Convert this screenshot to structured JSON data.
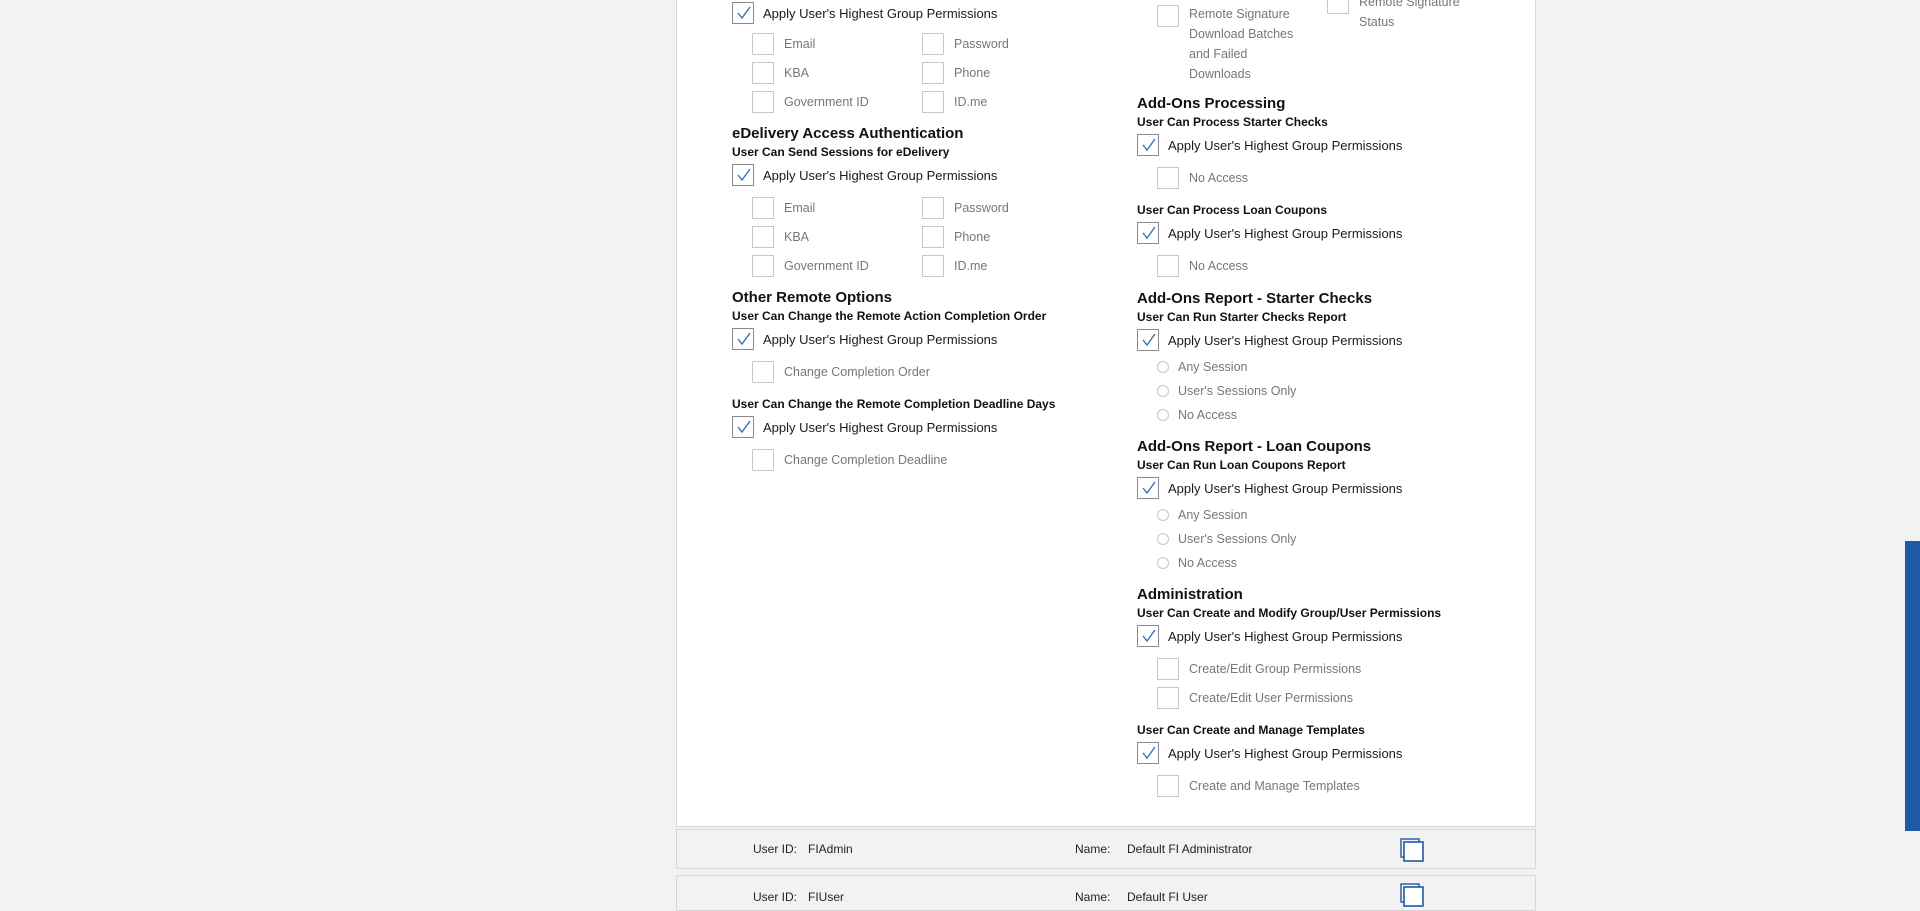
{
  "apply_label": "Apply User's Highest Group Permissions",
  "left": {
    "auth_top": {
      "items": [
        "Email",
        "Password",
        "KBA",
        "Phone",
        "Government ID",
        "ID.me"
      ]
    },
    "edelivery": {
      "title": "eDelivery Access Authentication",
      "perm": "User Can Send Sessions for eDelivery",
      "items": [
        "Email",
        "Password",
        "KBA",
        "Phone",
        "Government ID",
        "ID.me"
      ]
    },
    "other": {
      "title": "Other Remote Options",
      "perm1": "User Can Change the Remote Action Completion Order",
      "opt1": "Change Completion Order",
      "perm2": "User Can Change the Remote Completion Deadline Days",
      "opt2": "Change Completion Deadline"
    }
  },
  "right": {
    "top": {
      "opt_a": "Remote Signature Download Batches and Failed Downloads",
      "opt_b": "Remote Signature Status"
    },
    "processing": {
      "title": "Add-Ons Processing",
      "perm1": "User Can Process Starter Checks",
      "perm1_opt": "No Access",
      "perm2": "User Can Process Loan Coupons",
      "perm2_opt": "No Access"
    },
    "report_starter": {
      "title": "Add-Ons Report - Starter Checks",
      "perm": "User Can Run Starter Checks Report",
      "options": [
        "Any Session",
        "User's Sessions Only",
        "No Access"
      ]
    },
    "report_loan": {
      "title": "Add-Ons Report - Loan Coupons",
      "perm": "User Can Run Loan Coupons Report",
      "options": [
        "Any Session",
        "User's Sessions Only",
        "No Access"
      ]
    },
    "admin": {
      "title": "Administration",
      "perm1": "User Can Create and Modify Group/User Permissions",
      "perm1_opts": [
        "Create/Edit Group Permissions",
        "Create/Edit User Permissions"
      ],
      "perm2": "User Can Create and Manage Templates",
      "perm2_opt": "Create and Manage Templates"
    }
  },
  "users": [
    {
      "id_label": "User ID:",
      "id": "FIAdmin",
      "name_label": "Name:",
      "name": "Default FI Administrator"
    },
    {
      "id_label": "User ID:",
      "id": "FIUser",
      "name_label": "Name:",
      "name": "Default FI User"
    }
  ],
  "colors": {
    "accent": "#1f5aa6",
    "check": "#2e6db4"
  }
}
